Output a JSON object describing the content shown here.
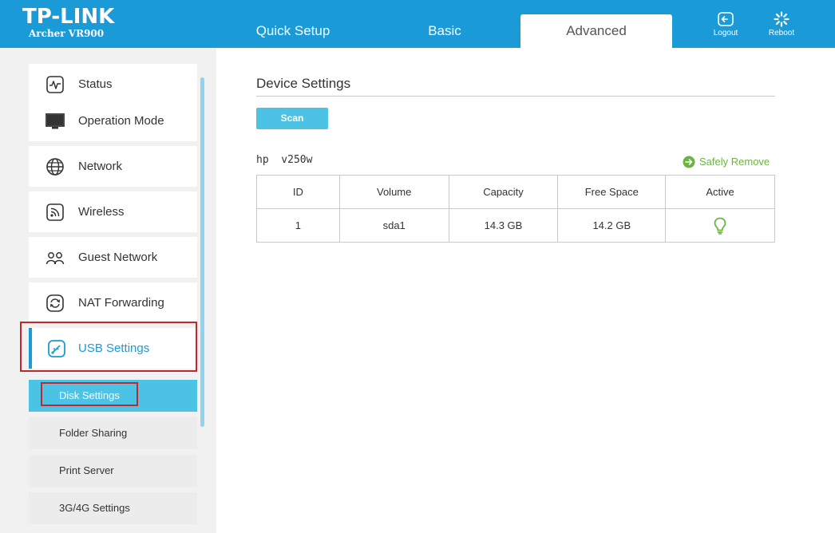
{
  "header": {
    "brand": "TP-LINK",
    "model": "Archer VR900",
    "tabs": [
      "Quick Setup",
      "Basic",
      "Advanced"
    ],
    "logout_label": "Logout",
    "reboot_label": "Reboot"
  },
  "sidebar": {
    "items": [
      {
        "label": "Status",
        "icon": "status-icon"
      },
      {
        "label": "Operation Mode",
        "icon": "monitor-icon"
      },
      {
        "label": "Network",
        "icon": "globe-icon"
      },
      {
        "label": "Wireless",
        "icon": "wireless-icon"
      },
      {
        "label": "Guest Network",
        "icon": "guest-icon"
      },
      {
        "label": "NAT Forwarding",
        "icon": "nat-icon"
      },
      {
        "label": "USB Settings",
        "icon": "usb-icon"
      }
    ],
    "sub_items": [
      "Disk Settings",
      "Folder Sharing",
      "Print Server",
      "3G/4G Settings"
    ]
  },
  "main": {
    "section_title": "Device Settings",
    "scan_label": "Scan",
    "device_name": "hp  v250w",
    "safely_remove_label": "Safely Remove",
    "table": {
      "headers": [
        "ID",
        "Volume",
        "Capacity",
        "Free Space",
        "Active"
      ],
      "rows": [
        {
          "id": "1",
          "volume": "sda1",
          "capacity": "14.3 GB",
          "free_space": "14.2 GB",
          "active": "bulb-icon"
        }
      ]
    }
  },
  "colors": {
    "accent": "#1b9ad8",
    "button": "#4cc2e4",
    "green": "#6ab53c",
    "highlight_box": "#c1272d"
  }
}
